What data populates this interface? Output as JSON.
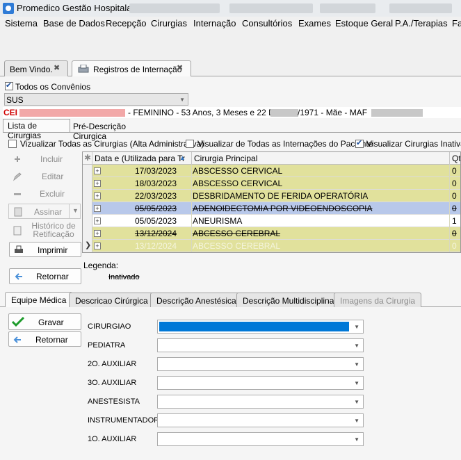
{
  "window": {
    "title": "Promedico Gestão Hospitalar"
  },
  "menu": [
    "Sistema",
    "Base de Dados",
    "Recepção",
    "Cirurgias",
    "Internação",
    "Consultórios",
    "Exames",
    "Estoque Geral",
    "P.A./Terapias",
    "Fa"
  ],
  "doc_tabs": [
    {
      "label": "Bem Vindo.",
      "close": "✖"
    },
    {
      "label": "Registros de Internação",
      "close": "✖"
    }
  ],
  "filters": {
    "todos_convenios_label": "Todos os Convênios",
    "convenio_value": "SUS"
  },
  "patient_bar": {
    "prefix": "CEI",
    "details": "- FEMININO - 53 Anos, 3 Meses e 22 Dias",
    "birth": "/1971 - Mãe - MAF"
  },
  "sub_tabs": [
    "Lista de Cirurgias",
    "Pré-Descrição Cirurgica"
  ],
  "options": {
    "alta": "Vizualizar Todas as Cirurgias (Alta Administrativa)",
    "internacoes": "Visualizar de Todas as Internações do Paciente",
    "inativas": "Visualizar Cirurgias Inativas"
  },
  "side_actions": {
    "incluir": "Incluir",
    "editar": "Editar",
    "excluir": "Excluir",
    "assinar": "Assinar",
    "historico": "Histórico de Retificação",
    "imprimir": "Imprimir",
    "retornar": "Retornar"
  },
  "grid": {
    "columns": {
      "date": "Data e (Utilizada para Tr",
      "surgery": "Cirurgia Principal",
      "qt": "Qt"
    },
    "rows": [
      {
        "date": "17/03/2023",
        "surgery": "ABSCESSO CERVICAL",
        "qt": "0",
        "style": "yellow",
        "strike": false
      },
      {
        "date": "18/03/2023",
        "surgery": "ABSCESSO CERVICAL",
        "qt": "0",
        "style": "yellow",
        "strike": false
      },
      {
        "date": "22/03/2023",
        "surgery": "DESBRIDAMENTO DE FERIDA OPERATÓRIA",
        "qt": "0",
        "style": "yellow",
        "strike": false
      },
      {
        "date": "05/05/2023",
        "surgery": "ADENOIDECTOMIA POR VIDEOENDOSCOPIA",
        "qt": "0",
        "style": "blue",
        "strike": true
      },
      {
        "date": "05/05/2023",
        "surgery": "ANEURISMA",
        "qt": "1",
        "style": "white",
        "strike": false
      },
      {
        "date": "13/12/2024",
        "surgery": "ABCESSO CEREBRAL",
        "qt": "0",
        "style": "yellow",
        "strike": true
      },
      {
        "date": "13/12/2024",
        "surgery": "ABCESSO CEREBRAL",
        "qt": "0",
        "style": "yellow-muted",
        "strike": false
      }
    ]
  },
  "legend": {
    "label": "Legenda:",
    "inativado": "Inativado"
  },
  "bottom_tabs": [
    "Equipe Médica",
    "Descricao Cirúrgica",
    "Descrição Anestésica",
    "Descrição Multidisciplinar",
    "Imagens da Cirurgia"
  ],
  "team_actions": {
    "gravar": "Gravar",
    "retornar": "Retornar"
  },
  "team_fields": [
    {
      "label": "CIRURGIAO",
      "value": ""
    },
    {
      "label": "PEDIATRA",
      "value": ""
    },
    {
      "label": "2O. AUXILIAR",
      "value": ""
    },
    {
      "label": "3O. AUXILIAR",
      "value": ""
    },
    {
      "label": "ANESTESISTA",
      "value": ""
    },
    {
      "label": "INSTRUMENTADOR",
      "value": ""
    },
    {
      "label": "1O. AUXILIAR",
      "value": ""
    }
  ],
  "colors": {
    "row_yellow": "#e1e19c",
    "row_blue": "#b8c8ea",
    "row_muted_text": "#f4f4dc",
    "patient_red": "#d00000",
    "accent": "#0078d7"
  }
}
